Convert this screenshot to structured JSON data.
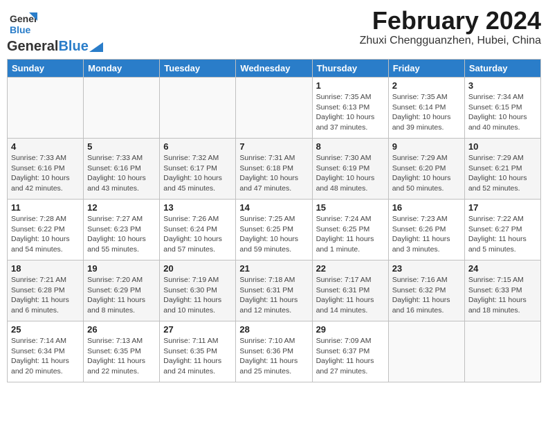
{
  "header": {
    "logo_general": "General",
    "logo_blue": "Blue",
    "title": "February 2024",
    "subtitle": "Zhuxi Chengguanzhen, Hubei, China"
  },
  "days_of_week": [
    "Sunday",
    "Monday",
    "Tuesday",
    "Wednesday",
    "Thursday",
    "Friday",
    "Saturday"
  ],
  "weeks": [
    [
      {
        "day": "",
        "info": ""
      },
      {
        "day": "",
        "info": ""
      },
      {
        "day": "",
        "info": ""
      },
      {
        "day": "",
        "info": ""
      },
      {
        "day": "1",
        "info": "Sunrise: 7:35 AM\nSunset: 6:13 PM\nDaylight: 10 hours and 37 minutes."
      },
      {
        "day": "2",
        "info": "Sunrise: 7:35 AM\nSunset: 6:14 PM\nDaylight: 10 hours and 39 minutes."
      },
      {
        "day": "3",
        "info": "Sunrise: 7:34 AM\nSunset: 6:15 PM\nDaylight: 10 hours and 40 minutes."
      }
    ],
    [
      {
        "day": "4",
        "info": "Sunrise: 7:33 AM\nSunset: 6:16 PM\nDaylight: 10 hours and 42 minutes."
      },
      {
        "day": "5",
        "info": "Sunrise: 7:33 AM\nSunset: 6:16 PM\nDaylight: 10 hours and 43 minutes."
      },
      {
        "day": "6",
        "info": "Sunrise: 7:32 AM\nSunset: 6:17 PM\nDaylight: 10 hours and 45 minutes."
      },
      {
        "day": "7",
        "info": "Sunrise: 7:31 AM\nSunset: 6:18 PM\nDaylight: 10 hours and 47 minutes."
      },
      {
        "day": "8",
        "info": "Sunrise: 7:30 AM\nSunset: 6:19 PM\nDaylight: 10 hours and 48 minutes."
      },
      {
        "day": "9",
        "info": "Sunrise: 7:29 AM\nSunset: 6:20 PM\nDaylight: 10 hours and 50 minutes."
      },
      {
        "day": "10",
        "info": "Sunrise: 7:29 AM\nSunset: 6:21 PM\nDaylight: 10 hours and 52 minutes."
      }
    ],
    [
      {
        "day": "11",
        "info": "Sunrise: 7:28 AM\nSunset: 6:22 PM\nDaylight: 10 hours and 54 minutes."
      },
      {
        "day": "12",
        "info": "Sunrise: 7:27 AM\nSunset: 6:23 PM\nDaylight: 10 hours and 55 minutes."
      },
      {
        "day": "13",
        "info": "Sunrise: 7:26 AM\nSunset: 6:24 PM\nDaylight: 10 hours and 57 minutes."
      },
      {
        "day": "14",
        "info": "Sunrise: 7:25 AM\nSunset: 6:25 PM\nDaylight: 10 hours and 59 minutes."
      },
      {
        "day": "15",
        "info": "Sunrise: 7:24 AM\nSunset: 6:25 PM\nDaylight: 11 hours and 1 minute."
      },
      {
        "day": "16",
        "info": "Sunrise: 7:23 AM\nSunset: 6:26 PM\nDaylight: 11 hours and 3 minutes."
      },
      {
        "day": "17",
        "info": "Sunrise: 7:22 AM\nSunset: 6:27 PM\nDaylight: 11 hours and 5 minutes."
      }
    ],
    [
      {
        "day": "18",
        "info": "Sunrise: 7:21 AM\nSunset: 6:28 PM\nDaylight: 11 hours and 6 minutes."
      },
      {
        "day": "19",
        "info": "Sunrise: 7:20 AM\nSunset: 6:29 PM\nDaylight: 11 hours and 8 minutes."
      },
      {
        "day": "20",
        "info": "Sunrise: 7:19 AM\nSunset: 6:30 PM\nDaylight: 11 hours and 10 minutes."
      },
      {
        "day": "21",
        "info": "Sunrise: 7:18 AM\nSunset: 6:31 PM\nDaylight: 11 hours and 12 minutes."
      },
      {
        "day": "22",
        "info": "Sunrise: 7:17 AM\nSunset: 6:31 PM\nDaylight: 11 hours and 14 minutes."
      },
      {
        "day": "23",
        "info": "Sunrise: 7:16 AM\nSunset: 6:32 PM\nDaylight: 11 hours and 16 minutes."
      },
      {
        "day": "24",
        "info": "Sunrise: 7:15 AM\nSunset: 6:33 PM\nDaylight: 11 hours and 18 minutes."
      }
    ],
    [
      {
        "day": "25",
        "info": "Sunrise: 7:14 AM\nSunset: 6:34 PM\nDaylight: 11 hours and 20 minutes."
      },
      {
        "day": "26",
        "info": "Sunrise: 7:13 AM\nSunset: 6:35 PM\nDaylight: 11 hours and 22 minutes."
      },
      {
        "day": "27",
        "info": "Sunrise: 7:11 AM\nSunset: 6:35 PM\nDaylight: 11 hours and 24 minutes."
      },
      {
        "day": "28",
        "info": "Sunrise: 7:10 AM\nSunset: 6:36 PM\nDaylight: 11 hours and 25 minutes."
      },
      {
        "day": "29",
        "info": "Sunrise: 7:09 AM\nSunset: 6:37 PM\nDaylight: 11 hours and 27 minutes."
      },
      {
        "day": "",
        "info": ""
      },
      {
        "day": "",
        "info": ""
      }
    ]
  ]
}
